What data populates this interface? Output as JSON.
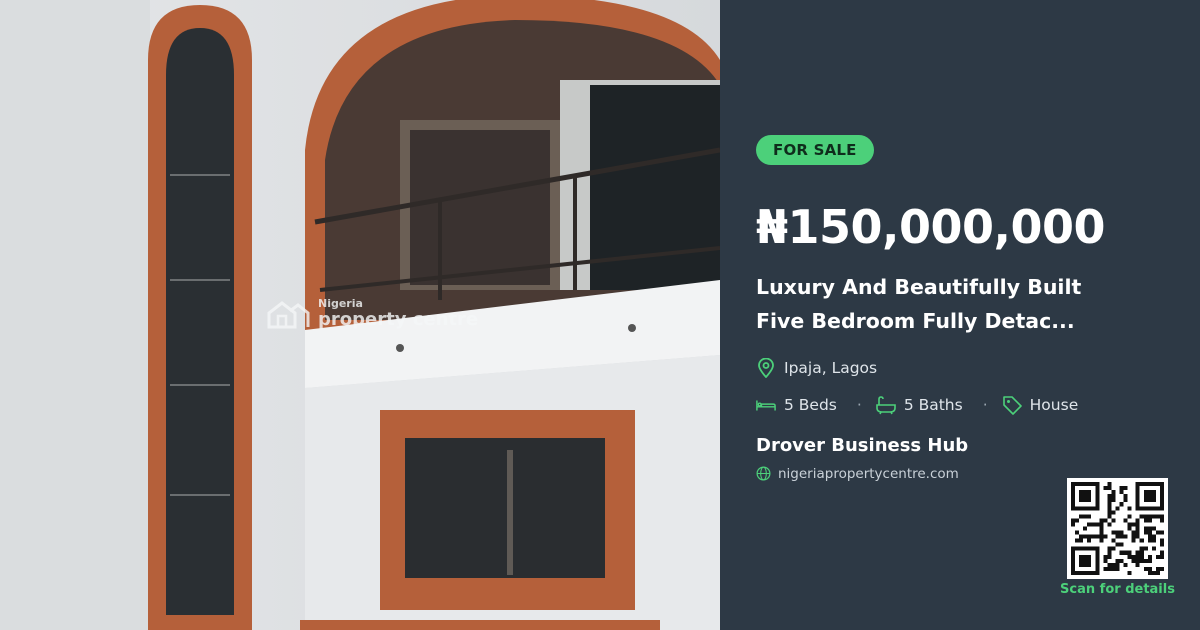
{
  "listing": {
    "badge": "FOR SALE",
    "price": "₦150,000,000",
    "title_line1": "Luxury And Beautifully Built",
    "title_line2": "Five Bedroom Fully Detac...",
    "location": "Ipaja, Lagos",
    "beds": "5 Beds",
    "baths": "5 Baths",
    "type": "House",
    "agent": "Drover Business Hub",
    "website": "nigeriapropertycentre.com",
    "scan_label": "Scan for details"
  },
  "watermark": {
    "small": "Nigeria",
    "big": "property centre"
  },
  "colors": {
    "panel_bg": "#2d3945",
    "accent": "#4cd07a"
  },
  "icons": {
    "location": "map-pin-icon",
    "beds": "bed-icon",
    "baths": "bathtub-icon",
    "type": "tag-icon",
    "website": "globe-icon"
  }
}
